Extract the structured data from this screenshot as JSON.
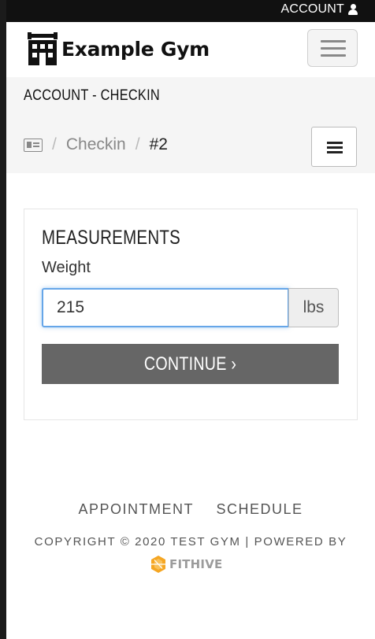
{
  "topbar": {
    "account_label": "ACCOUNT"
  },
  "brand": {
    "name": "Example Gym"
  },
  "page": {
    "title": "ACCOUNT - CHECKIN"
  },
  "breadcrumb": {
    "items": [
      "Checkin",
      "#2"
    ],
    "separator": "/"
  },
  "panel": {
    "title": "MEASUREMENTS",
    "weight_label": "Weight",
    "weight_value": "215",
    "weight_unit": "lbs",
    "continue_label": "CONTINUE ›"
  },
  "footer": {
    "links": [
      "APPOINTMENT",
      "SCHEDULE"
    ],
    "copyright": "COPYRIGHT © 2020 TEST GYM  |  POWERED BY",
    "powered_logo": "FITHIVE"
  },
  "colors": {
    "topbar_bg": "#111111",
    "button_bg": "#666666",
    "input_focus": "#66a6e8",
    "hive_orange": "#f5a623"
  },
  "icons": [
    "user-icon",
    "gym-building-icon",
    "hamburger-icon",
    "id-card-icon",
    "menu-icon",
    "hive-logo-icon"
  ]
}
